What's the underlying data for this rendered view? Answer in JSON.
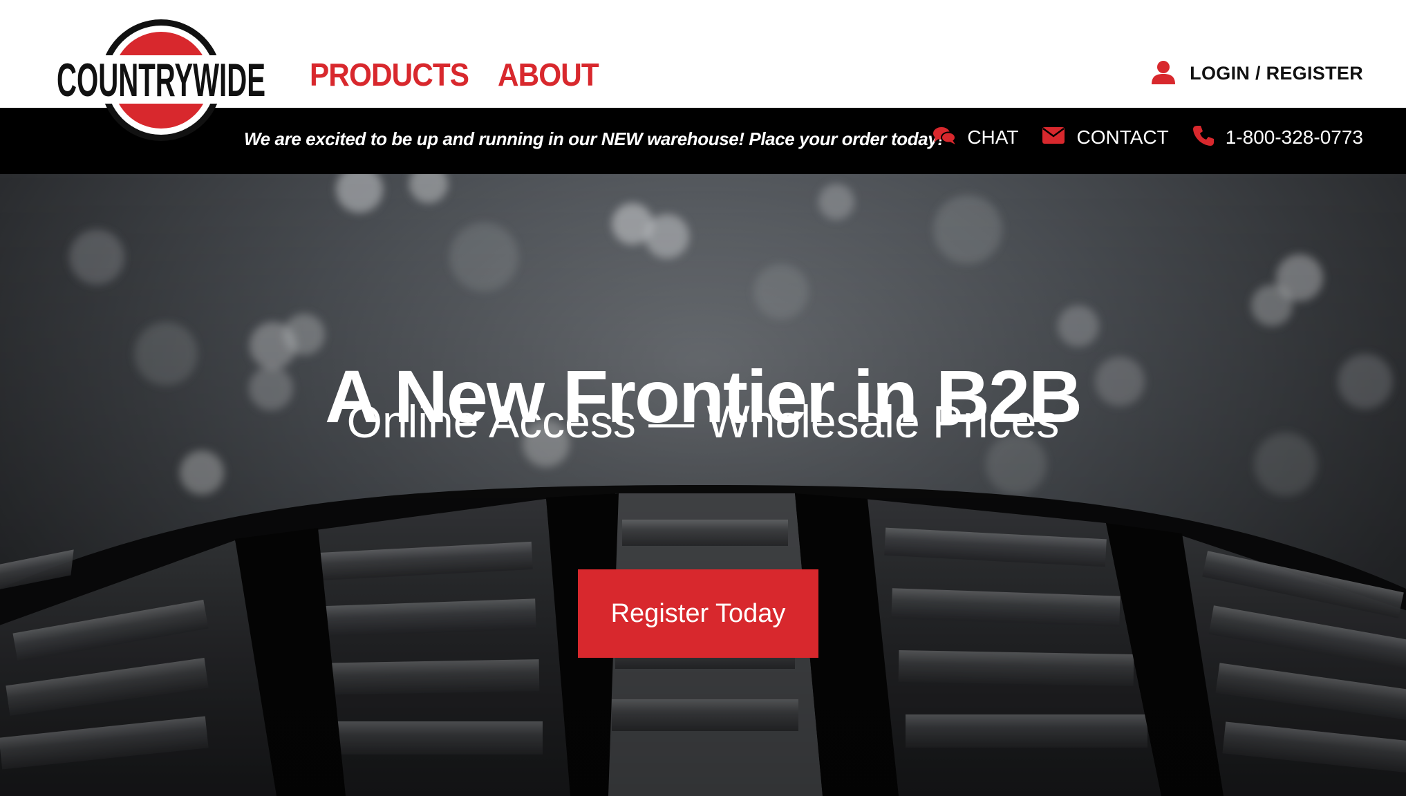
{
  "brand": {
    "logo_text": "COUNTRYWIDE",
    "accent_color": "#d8282d"
  },
  "nav": {
    "items": [
      {
        "label": "PRODUCTS"
      },
      {
        "label": "ABOUT"
      }
    ]
  },
  "account": {
    "icon": "user-icon",
    "label": "LOGIN / REGISTER"
  },
  "topbar": {
    "announcement": "We are excited to be up and running in our NEW warehouse! Place your order today!",
    "contacts": [
      {
        "icon": "chat-icon",
        "label": "CHAT"
      },
      {
        "icon": "envelope-icon",
        "label": "CONTACT"
      },
      {
        "icon": "phone-icon",
        "label": "1-800-328-0773"
      }
    ]
  },
  "hero": {
    "title": "A New Frontier in B2B",
    "subtitle": "Online Access — Wholesale Prices",
    "cta_label": "Register Today",
    "background": "tire-tread-image"
  }
}
